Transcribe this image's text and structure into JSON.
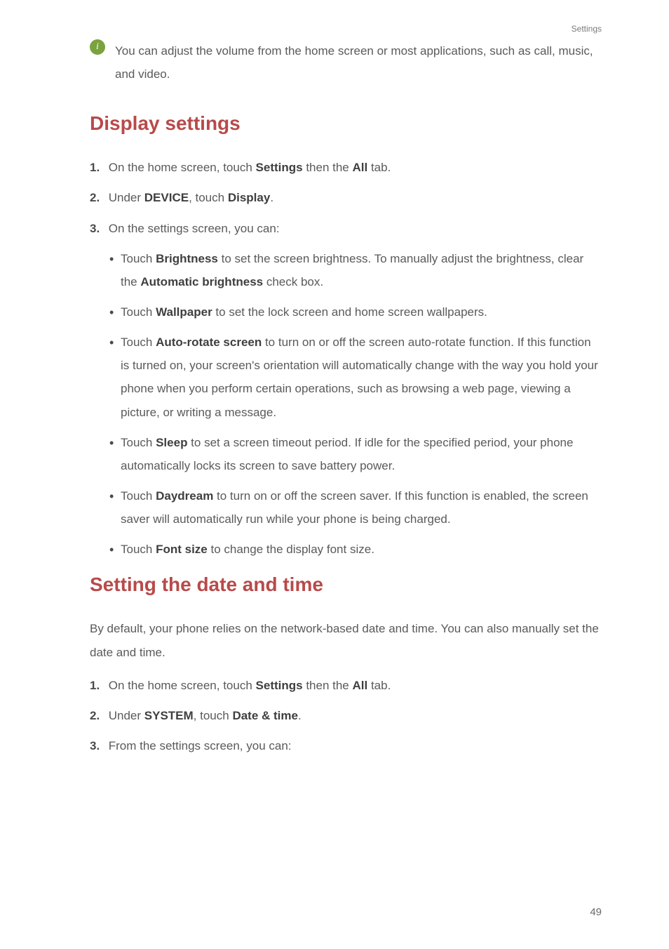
{
  "header": {
    "section": "Settings"
  },
  "info": {
    "icon": "i",
    "text": "You can adjust the volume from the home screen or most applications, such as call, music, and video."
  },
  "section1": {
    "title": "Display settings",
    "steps": {
      "s1": {
        "num": "1.",
        "pre": "On the home screen, touch ",
        "b1": "Settings",
        "mid": " then the ",
        "b2": "All",
        "post": " tab."
      },
      "s2": {
        "num": "2.",
        "pre": "Under ",
        "b1": "DEVICE",
        "mid": ", touch ",
        "b2": "Display",
        "post": "."
      },
      "s3": {
        "num": "3.",
        "text": "On the settings screen, you can:"
      }
    },
    "bullets": {
      "b1": {
        "pre": "Touch ",
        "bold": "Brightness",
        "mid": " to set the screen brightness. To manually adjust the brightness, clear the ",
        "bold2": "Automatic brightness",
        "post": " check box."
      },
      "b2": {
        "pre": "Touch ",
        "bold": "Wallpaper",
        "post": " to set the lock screen and home screen wallpapers."
      },
      "b3": {
        "pre": "Touch ",
        "bold": "Auto-rotate screen",
        "post": " to turn on or off the screen auto-rotate function. If this function is turned on, your screen's orientation will automatically change with the way you hold your phone when you perform certain operations, such as browsing a web page, viewing a picture, or writing a message."
      },
      "b4": {
        "pre": "Touch ",
        "bold": "Sleep",
        "post": " to set a screen timeout period. If idle for the specified period, your phone automatically locks its screen to save battery power."
      },
      "b5": {
        "pre": "Touch ",
        "bold": "Daydream",
        "post": " to turn on or off the screen saver. If this function is enabled, the screen saver will automatically run while your phone is being charged."
      },
      "b6": {
        "pre": "Touch ",
        "bold": "Font size",
        "post": " to change the display font size."
      }
    }
  },
  "section2": {
    "title": "Setting the date and time",
    "intro": "By default, your phone relies on the network-based date and time. You can also manually set the date and time.",
    "steps": {
      "s1": {
        "num": "1.",
        "pre": "On the home screen, touch ",
        "b1": "Settings",
        "mid": " then the ",
        "b2": "All",
        "post": " tab."
      },
      "s2": {
        "num": "2.",
        "pre": "Under ",
        "b1": "SYSTEM",
        "mid": ", touch ",
        "b2": "Date & time",
        "post": "."
      },
      "s3": {
        "num": "3.",
        "text": "From the settings screen, you can:"
      }
    }
  },
  "page": "49"
}
